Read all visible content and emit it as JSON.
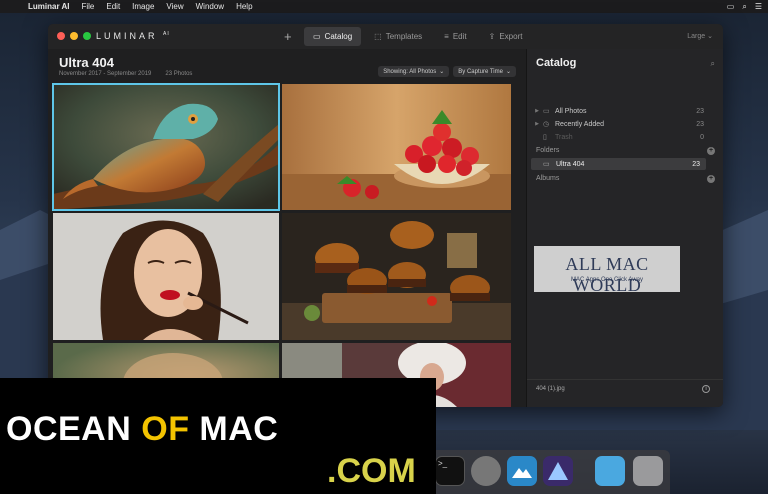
{
  "menubar": {
    "app_name": "Luminar AI",
    "items": [
      "File",
      "Edit",
      "Image",
      "View",
      "Window",
      "Help"
    ]
  },
  "window": {
    "logo": "LUMINAR",
    "logo_suffix": "AI",
    "tabs": [
      {
        "label": "Catalog",
        "icon": "folder-icon",
        "active": true
      },
      {
        "label": "Templates",
        "icon": "templates-icon",
        "active": false
      },
      {
        "label": "Edit",
        "icon": "sliders-icon",
        "active": false
      },
      {
        "label": "Export",
        "icon": "export-icon",
        "active": false
      }
    ],
    "size_option": "Large"
  },
  "album": {
    "title": "Ultra 404",
    "date_range": "November 2017 - September 2019",
    "photo_count": "23 Photos",
    "filter_showing": "Showing: All Photos",
    "filter_sort": "By Capture Time"
  },
  "photos": [
    {
      "subject": "chameleon",
      "selected": true
    },
    {
      "subject": "strawberries",
      "selected": false
    },
    {
      "subject": "woman-lipstick",
      "selected": false
    },
    {
      "subject": "burgers",
      "selected": false
    },
    {
      "subject": "blurred",
      "selected": false
    },
    {
      "subject": "fur-hat-woman",
      "selected": false
    }
  ],
  "panel": {
    "title": "Catalog",
    "items": [
      {
        "label": "All Photos",
        "count": "23"
      },
      {
        "label": "Recently Added",
        "count": "23"
      },
      {
        "label": "Trash",
        "count": "0"
      }
    ],
    "folders_label": "Folders",
    "folder": {
      "label": "Ultra 404",
      "count": "23"
    },
    "albums_label": "Albums",
    "selected_file": "404 (1).jpg"
  },
  "watermark": {
    "title": "ALL MAC WORLD",
    "subtitle": "MAC Apps One Click Away"
  },
  "banner": {
    "word1": "OCEAN",
    "word2": "OF",
    "word3": "MAC",
    "suffix": ".COM"
  },
  "colors": {
    "accent": "#5ec6e8",
    "banner_yellow": "#f3c300"
  }
}
